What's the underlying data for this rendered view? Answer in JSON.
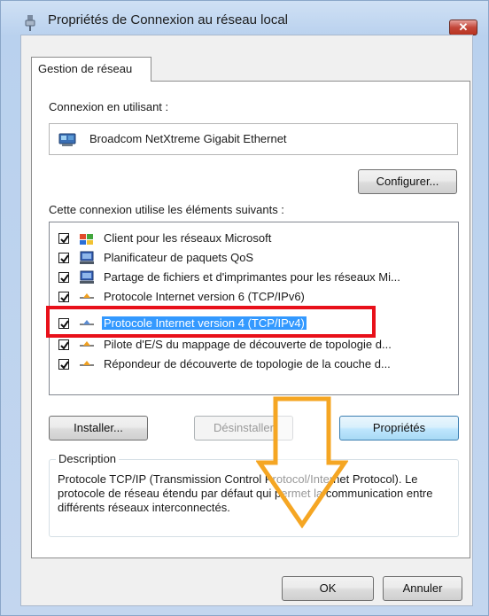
{
  "window": {
    "title": "Propriétés de Connexion au réseau local",
    "close_glyph": "✕"
  },
  "tabs": [
    {
      "label": "Gestion de réseau"
    }
  ],
  "connect_using": {
    "label": "Connexion en utilisant :",
    "adapter": "Broadcom NetXtreme Gigabit Ethernet",
    "configure_button": "Configurer..."
  },
  "items_section": {
    "label": "Cette connexion utilise les éléments suivants :",
    "items": [
      {
        "label": "Client pour les réseaux Microsoft",
        "checked": true,
        "icon": "network-client-icon"
      },
      {
        "label": "Planificateur de paquets QoS",
        "checked": true,
        "icon": "service-icon"
      },
      {
        "label": "Partage de fichiers et d'imprimantes pour les réseaux Mi...",
        "checked": true,
        "icon": "service-icon"
      },
      {
        "label": "Protocole Internet version 6 (TCP/IPv6)",
        "checked": true,
        "icon": "protocol-icon"
      },
      {
        "label": "Protocole Internet version 4 (TCP/IPv4)",
        "checked": true,
        "icon": "protocol-icon",
        "selected": true
      },
      {
        "label": "Pilote d'E/S du mappage de découverte de topologie d...",
        "checked": true,
        "icon": "protocol-icon"
      },
      {
        "label": "Répondeur de découverte de topologie de la couche d...",
        "checked": true,
        "icon": "protocol-icon"
      }
    ]
  },
  "buttons": {
    "install": "Installer...",
    "uninstall": "Désinstaller",
    "properties": "Propriétés",
    "ok": "OK",
    "cancel": "Annuler"
  },
  "description": {
    "legend": "Description",
    "text": "Protocole TCP/IP (Transmission Control Protocol/Internet Protocol). Le protocole de réseau étendu par défaut qui permet la communication entre différents réseaux interconnectés."
  },
  "colors": {
    "highlight_box": "#e8101a",
    "annotation_arrow": "#f5a623",
    "selection": "#3399ff"
  }
}
